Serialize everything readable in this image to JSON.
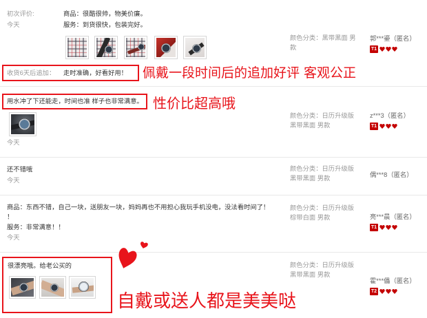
{
  "colors": {
    "annotation": "#e8141b",
    "text": "#333333",
    "muted": "#999999",
    "badge": "#c40000"
  },
  "level_icon": "heart-icon",
  "reviews": [
    {
      "label": "初次评价:",
      "lines": [
        "商品：很酷很帅，物美价廉。",
        "服务：到货很快，包装完好。"
      ],
      "date": "今天",
      "append_label": "收货6天后追加：",
      "append_text": "走时准确，好看好用！",
      "sku": [
        "颜色分类：黑带黑面 男",
        "款"
      ],
      "user": "郭***鎏（匿名）",
      "level": "T1"
    },
    {
      "lines": [
        "用水冲了下还能走，时间也准 样子也非常满意。"
      ],
      "date": "今天",
      "sku": [
        "颜色分类：日历升级版",
        "黑带黑面 男款"
      ],
      "user": "z***3（匿名）",
      "level": "T1"
    },
    {
      "lines": [
        "还不错哦"
      ],
      "date": "今天",
      "sku": [
        "颜色分类：日历升级版",
        "黑带黑面 男款"
      ],
      "user": "偶***8（匿名）"
    },
    {
      "lines": [
        "商品：东西不错，自己一块，送朋友一块，妈妈再也不用担心我玩手机没电，没法看时间了！",
        "！",
        "服务：非常满意！！"
      ],
      "date": "今天",
      "sku": [
        "颜色分类：日历升级版",
        "棕带白面 男款"
      ],
      "user": "亮***晨（匿名）",
      "level": "T1"
    },
    {
      "lines": [
        "很漂亮哦。给老公买的"
      ],
      "sku": [
        "颜色分类：日历升级版",
        "黑带黑面 男款"
      ],
      "user": "霍***儡（匿名）",
      "level": "T2"
    }
  ],
  "annotations": [
    "佩戴一段时间后的追加好评 客观公正",
    "性价比超高哦",
    "自戴或送人都是美美哒"
  ]
}
